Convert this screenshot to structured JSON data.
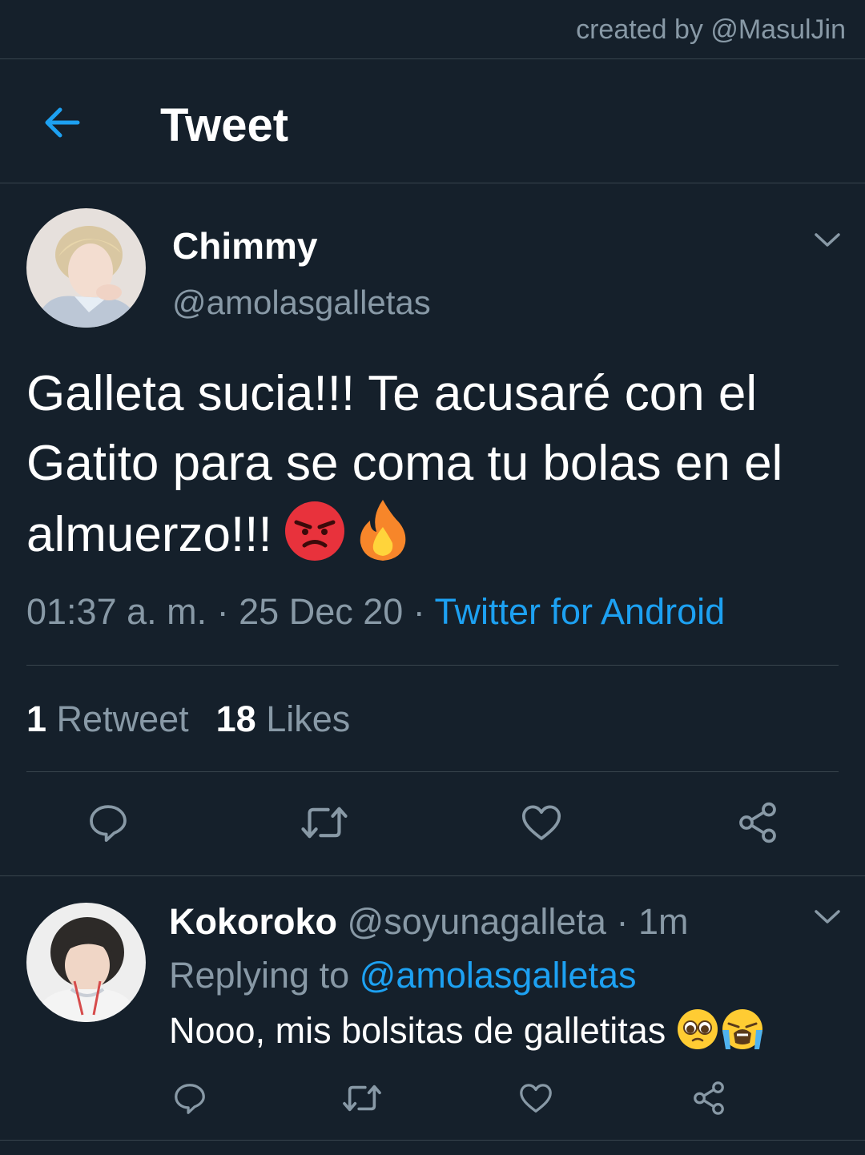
{
  "credit": "created by @MasulJin",
  "header": {
    "title": "Tweet",
    "back_icon": "arrow-left-icon"
  },
  "colors": {
    "background": "#15202b",
    "accent": "#1da1f2",
    "secondary_text": "#8899a6",
    "border": "#38444d",
    "primary_text": "#ffffff"
  },
  "tweet": {
    "name": "Chimmy",
    "handle": "@amolasgalletas",
    "text": "Galleta sucia!!! Te acusaré con el Gatito para se coma tu bolas en el almuerzo!!!",
    "emojis": [
      "angry-face-emoji",
      "fire-emoji"
    ],
    "time": "01:37 a. m.",
    "sep1": " · ",
    "date": "25 Dec 20",
    "sep2": " · ",
    "source": "Twitter for Android",
    "retweets_count": "1",
    "retweets_label": "Retweet",
    "likes_count": "18",
    "likes_label": "Likes"
  },
  "reply": {
    "name": "Kokoroko",
    "handle": "@soyunagalleta",
    "dot": " · ",
    "time": "1m",
    "replying_prefix": "Replying to ",
    "replying_handle": "@amolasgalletas",
    "text": "Nooo, mis bolsitas de galletitas",
    "emojis": [
      "pleading-face-emoji",
      "loudly-crying-face-emoji"
    ]
  }
}
